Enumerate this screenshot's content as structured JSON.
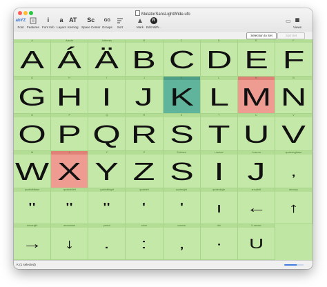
{
  "window": {
    "title": "MutatorSansLightWide.ufo",
    "colors": {
      "close": "#ff5f57",
      "minimize": "#febc2e",
      "zoom": "#28c840"
    }
  },
  "toolbar": {
    "items": [
      {
        "label": "Font",
        "icon": "font-icon"
      },
      {
        "label": "Features",
        "icon": "features-icon"
      },
      {
        "label": "Font Info",
        "icon": "info-icon"
      },
      {
        "label": "Layers",
        "icon": "layers-icon"
      },
      {
        "label": "Kerning",
        "icon": "kerning-icon"
      },
      {
        "label": "Space Center",
        "icon": "space-center-icon"
      },
      {
        "label": "Groups",
        "icon": "groups-icon"
      },
      {
        "label": "Sort",
        "icon": "sort-icon"
      },
      {
        "label": "Mark",
        "icon": "mark-icon"
      },
      {
        "label": "Edit With...",
        "icon": "edit-with-icon"
      },
      {
        "label": "Views",
        "icon": "views-icon"
      }
    ],
    "font_icon_text": "abYZ",
    "info_icon_text": "i",
    "layers_icon_text": "a",
    "kerning_icon_text": "AT",
    "space_icon_text": "Sc",
    "groups_icon_text": "GG",
    "edit_icon_text": "R"
  },
  "subbar": {
    "selection_to_set": "Selection to Set",
    "sort_set": "Sort Set"
  },
  "glyphs": [
    {
      "name": "A",
      "char": "A"
    },
    {
      "name": "Aacute",
      "char": "Á"
    },
    {
      "name": "Adieresis",
      "char": "Ä"
    },
    {
      "name": "B",
      "char": "B"
    },
    {
      "name": "C",
      "char": "C"
    },
    {
      "name": "D",
      "char": "D"
    },
    {
      "name": "E",
      "char": "E"
    },
    {
      "name": "F",
      "char": "F"
    },
    {
      "name": "G",
      "char": "G"
    },
    {
      "name": "H",
      "char": "H"
    },
    {
      "name": "I",
      "char": "I"
    },
    {
      "name": "J",
      "char": "J"
    },
    {
      "name": "K",
      "char": "K",
      "mark": "teal"
    },
    {
      "name": "L",
      "char": "L"
    },
    {
      "name": "M",
      "char": "M",
      "mark": "red"
    },
    {
      "name": "N",
      "char": "N"
    },
    {
      "name": "O",
      "char": "O"
    },
    {
      "name": "P",
      "char": "P"
    },
    {
      "name": "Q",
      "char": "Q"
    },
    {
      "name": "R",
      "char": "R"
    },
    {
      "name": "S",
      "char": "S"
    },
    {
      "name": "T",
      "char": "T"
    },
    {
      "name": "U",
      "char": "U"
    },
    {
      "name": "V",
      "char": "V"
    },
    {
      "name": "W",
      "char": "W"
    },
    {
      "name": "X",
      "char": "X",
      "mark": "red"
    },
    {
      "name": "Y",
      "char": "Y"
    },
    {
      "name": "Z",
      "char": "Z"
    },
    {
      "name": "S.closed",
      "char": "S"
    },
    {
      "name": "I.narrow",
      "char": "I"
    },
    {
      "name": "J.narrow",
      "char": "J"
    },
    {
      "name": "quotesinglbase",
      "char": "‚"
    },
    {
      "name": "quotedblbase",
      "char": "\""
    },
    {
      "name": "quotedblleft",
      "char": "\""
    },
    {
      "name": "quotedblright",
      "char": "\""
    },
    {
      "name": "quoteleft",
      "char": "'"
    },
    {
      "name": "quoteright",
      "char": "'"
    },
    {
      "name": "quotesingle",
      "char": "ı"
    },
    {
      "name": "arrowleft",
      "char": "←"
    },
    {
      "name": "arrowup",
      "char": "↑"
    },
    {
      "name": "arrowright",
      "char": "→"
    },
    {
      "name": "arrowdown",
      "char": "↓"
    },
    {
      "name": "period",
      "char": "."
    },
    {
      "name": "colon",
      "char": ":"
    },
    {
      "name": "comma",
      "char": ","
    },
    {
      "name": "dot",
      "char": "·"
    },
    {
      "name": "U.narrow",
      "char": "U"
    }
  ],
  "status": {
    "text": "K (1 selected)",
    "zoom_fraction": 0.65
  }
}
